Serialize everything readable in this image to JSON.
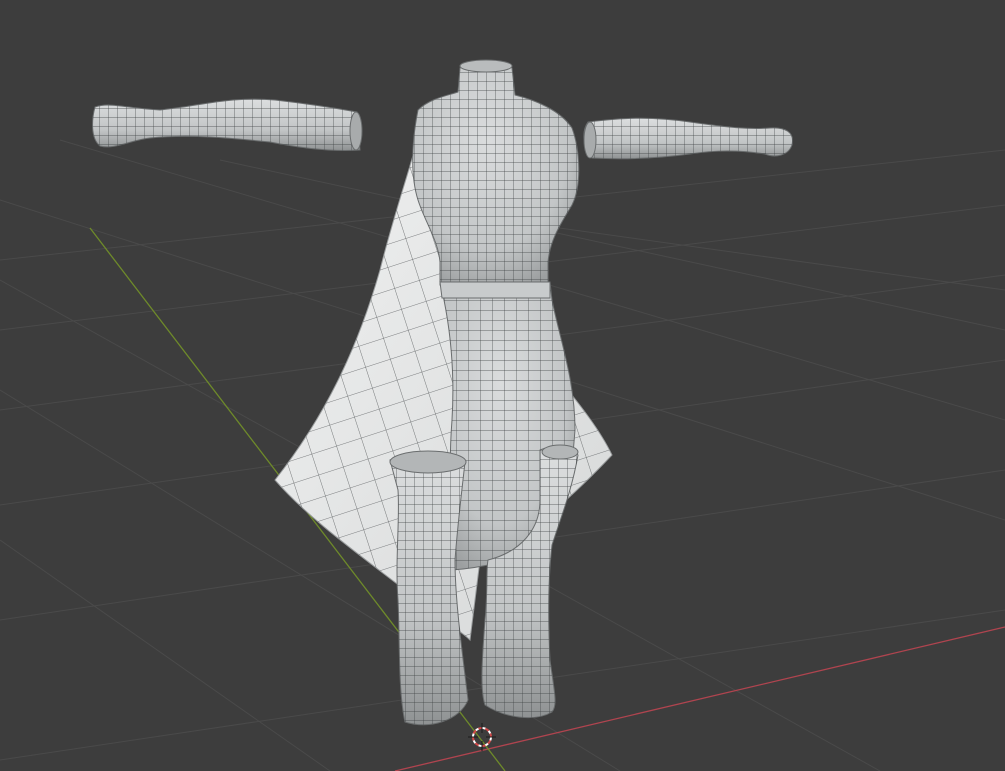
{
  "viewport": {
    "background": "#3d3d3d",
    "grid_color": "#4a4a4a",
    "x_axis_color": "#b0444f",
    "y_axis_color": "#6e8a2a",
    "mesh_fill": "#cfd2d3",
    "mesh_shade": "#a7aaab",
    "wire_color": "#3c3f41",
    "cloth_fill": "#e6e8e8"
  },
  "scene": {
    "objects": [
      "torso",
      "left-arm",
      "right-arm",
      "skirt",
      "cape",
      "left-boot",
      "right-boot"
    ],
    "cursor": "3d-cursor-icon"
  }
}
